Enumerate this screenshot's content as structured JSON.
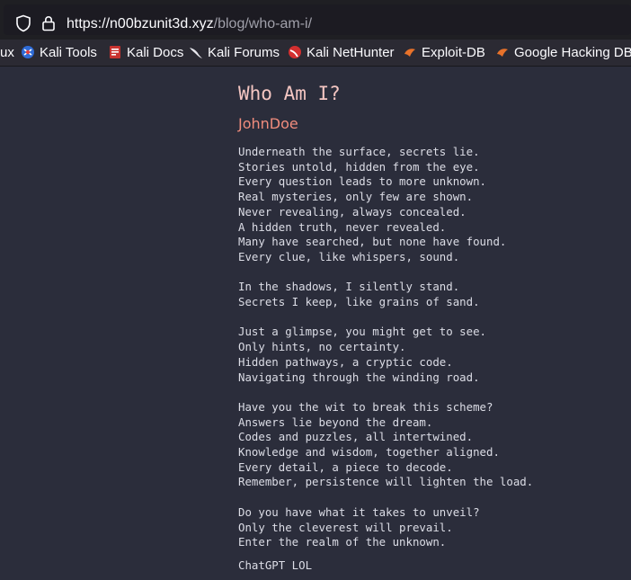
{
  "browser": {
    "url_host": "https://n00bzunit3d.xyz",
    "url_path": "/blog/who-am-i/",
    "bookmarks": [
      {
        "label": "ux",
        "icon": "truncated-bookmark"
      },
      {
        "label": "Kali Tools",
        "icon": "kali-tools-icon"
      },
      {
        "label": "Kali Docs",
        "icon": "kali-docs-icon"
      },
      {
        "label": "Kali Forums",
        "icon": "kali-dragon-icon"
      },
      {
        "label": "Kali NetHunter",
        "icon": "nethunter-icon"
      },
      {
        "label": "Exploit-DB",
        "icon": "exploit-db-icon"
      },
      {
        "label": "Google Hacking DB",
        "icon": "exploit-db-icon"
      }
    ]
  },
  "post": {
    "title": "Who Am I?",
    "author": "JohnDoe",
    "stanzas": [
      [
        "Underneath the surface, secrets lie.",
        "Stories untold, hidden from the eye.",
        "Every question leads to more unknown.",
        "Real mysteries, only few are shown.",
        "Never revealing, always concealed.",
        "A hidden truth, never revealed.",
        "Many have searched, but none have found.",
        "Every clue, like whispers, sound."
      ],
      [
        "In the shadows, I silently stand.",
        "Secrets I keep, like grains of sand."
      ],
      [
        "Just a glimpse, you might get to see.",
        "Only hints, no certainty.",
        "Hidden pathways, a cryptic code.",
        "Navigating through the winding road."
      ],
      [
        "Have you the wit to break this scheme?",
        "Answers lie beyond the dream.",
        "Codes and puzzles, all intertwined.",
        "Knowledge and wisdom, together aligned.",
        "Every detail, a piece to decode.",
        "Remember, persistence will lighten the load."
      ],
      [
        "Do you have what it takes to unveil?",
        "Only the cleverest will prevail.",
        "Enter the realm of the unknown."
      ]
    ],
    "footer": "ChatGPT LOL"
  },
  "colors": {
    "page_bg": "#2b2d3b",
    "title": "#f4c6c2",
    "author": "#f08c7d",
    "text": "#dcdde6"
  }
}
